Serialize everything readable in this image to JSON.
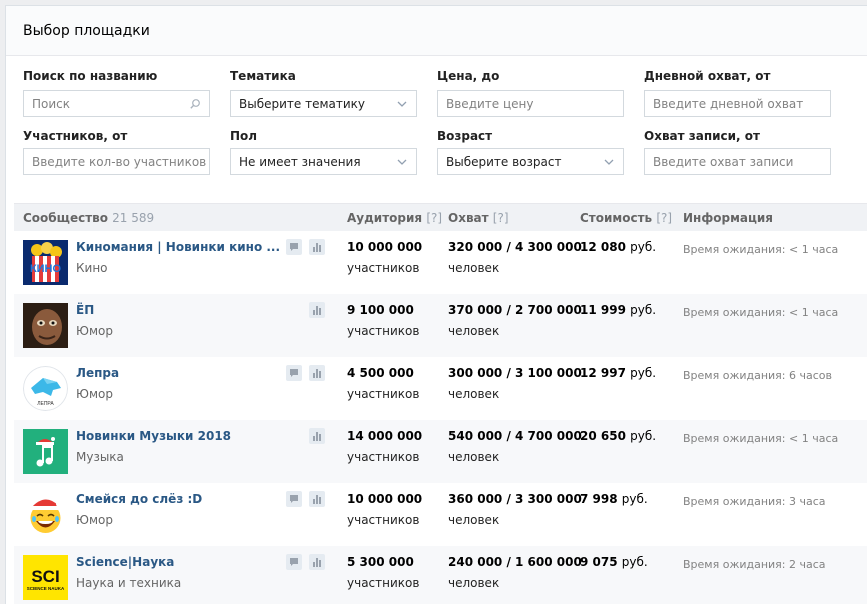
{
  "header": {
    "title": "Выбор площадки"
  },
  "filters": {
    "name": {
      "label": "Поиск по названию",
      "placeholder": "Поиск"
    },
    "topic": {
      "label": "Тематика",
      "value": "Выберите тематику"
    },
    "price": {
      "label": "Цена, до",
      "placeholder": "Введите цену"
    },
    "daily_reach": {
      "label": "Дневной охват, от",
      "placeholder": "Введите дневной охват"
    },
    "members": {
      "label": "Участников, от",
      "placeholder": "Введите кол-во участников"
    },
    "gender": {
      "label": "Пол",
      "value": "Не имеет значения"
    },
    "age": {
      "label": "Возраст",
      "value": "Выберите возраст"
    },
    "post_reach": {
      "label": "Охват записи, от",
      "placeholder": "Введите охват записи"
    }
  },
  "table": {
    "headers": {
      "community": "Сообщество",
      "count": "21 589",
      "audience": "Аудитория",
      "reach": "Охват",
      "price": "Стоимость",
      "info": "Информация",
      "hint": "[?]"
    },
    "rows": [
      {
        "name": "Киномания | Новинки кино ...",
        "category": "Кино",
        "audience": "10 000 000",
        "audience_unit": "участников",
        "reach": "320 000 / 4 300 000",
        "reach_unit": "человек",
        "price": "12 080",
        "currency": "руб.",
        "info": "Время ожидания: < 1 часа",
        "has_msg": true
      },
      {
        "name": "ЁП",
        "category": "Юмор",
        "audience": "9 100 000",
        "audience_unit": "участников",
        "reach": "370 000 / 2 700 000",
        "reach_unit": "человек",
        "price": "11 999",
        "currency": "руб.",
        "info": "Время ожидания: < 1 часа",
        "has_msg": false
      },
      {
        "name": "Лепра",
        "category": "Юмор",
        "audience": "4 500 000",
        "audience_unit": "участников",
        "reach": "300 000 / 3 100 000",
        "reach_unit": "человек",
        "price": "12 997",
        "currency": "руб.",
        "info": "Время ожидания: 6 часов",
        "has_msg": true
      },
      {
        "name": "Новинки Музыки 2018",
        "category": "Музыка",
        "audience": "14 000 000",
        "audience_unit": "участников",
        "reach": "540 000 / 4 700 000",
        "reach_unit": "человек",
        "price": "20 650",
        "currency": "руб.",
        "info": "Время ожидания: < 1 часа",
        "has_msg": false
      },
      {
        "name": "Смейся до слёз :D",
        "category": "Юмор",
        "audience": "10 000 000",
        "audience_unit": "участников",
        "reach": "360 000 / 3 300 000",
        "reach_unit": "человек",
        "price": "7 998",
        "currency": "руб.",
        "info": "Время ожидания: 3 часа",
        "has_msg": true
      },
      {
        "name": "Science|Наука",
        "category": "Наука и техника",
        "audience": "5 300 000",
        "audience_unit": "участников",
        "reach": "240 000 / 1 600 000",
        "reach_unit": "человек",
        "price": "9 075",
        "currency": "руб.",
        "info": "Время ожидания: 2 часа",
        "has_msg": true
      }
    ]
  },
  "avatars": {
    "row3_text": "ЛЕПРА",
    "row6_text": "SCI",
    "row6_sub": "SCIENCE NAUKA",
    "row1_text": "КИНО"
  }
}
